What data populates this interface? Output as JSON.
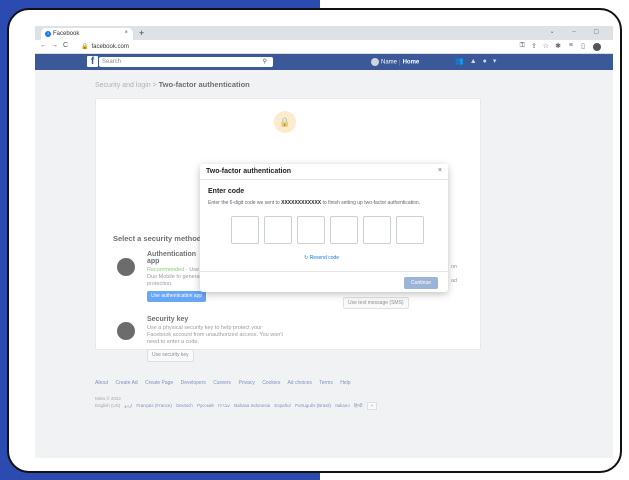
{
  "browser": {
    "tab_title": "Facebook",
    "tab_close": "×",
    "new_tab": "+",
    "window_controls": "⌄ – ▢",
    "back": "←",
    "forward": "→",
    "reload": "C",
    "url": "facebook.com",
    "lock": "🔒"
  },
  "fb": {
    "logo": "f",
    "search_placeholder": "Search",
    "name": "Name",
    "home": "Home"
  },
  "page": {
    "breadcrumb_parent": "Security and login",
    "breadcrumb_sep": " > ",
    "breadcrumb_current": "Two-factor authentication",
    "select_title": "Select a security method",
    "auth_app": {
      "title": "Authentication app",
      "recommended": "Recommended",
      "desc1": "· Use",
      "desc2": "Duo Mobile to generat",
      "desc3": "protection.",
      "button": "Use authentication app"
    },
    "text_message": {
      "frag1": "on",
      "frag2": "ad",
      "button": "Use text message (SMS)"
    },
    "security_key": {
      "title": "Security key",
      "desc1": "Use a physical security key to help protect your",
      "desc2": "Facebook account from unauthorized access. You won't",
      "desc3": "need to enter a code.",
      "button": "Use security key"
    }
  },
  "footer": {
    "links": [
      "About",
      "Create Ad",
      "Create Page",
      "Developers",
      "Careers",
      "Privacy",
      "Cookies",
      "Ad choices",
      "Terms",
      "Help"
    ],
    "meta": "Meta © 2022",
    "current_lang": "English (US)",
    "langs": [
      "اردو",
      "Français (France)",
      "Deutsch",
      "Русский",
      "עברית",
      "Bahasa Indonesia",
      "Español",
      "Português (Brasil)",
      "Italiano",
      "हिन्दी"
    ],
    "more": "+"
  },
  "modal": {
    "title": "Two-factor authentication",
    "close": "×",
    "subtitle": "Enter code",
    "desc_prefix": "Enter the 6-digit code we sent to ",
    "desc_number": "XXXXXXXXXXXX",
    "desc_suffix": " to finish setting up two-factor authentication.",
    "resend": "Resend code",
    "continue": "Continue"
  }
}
